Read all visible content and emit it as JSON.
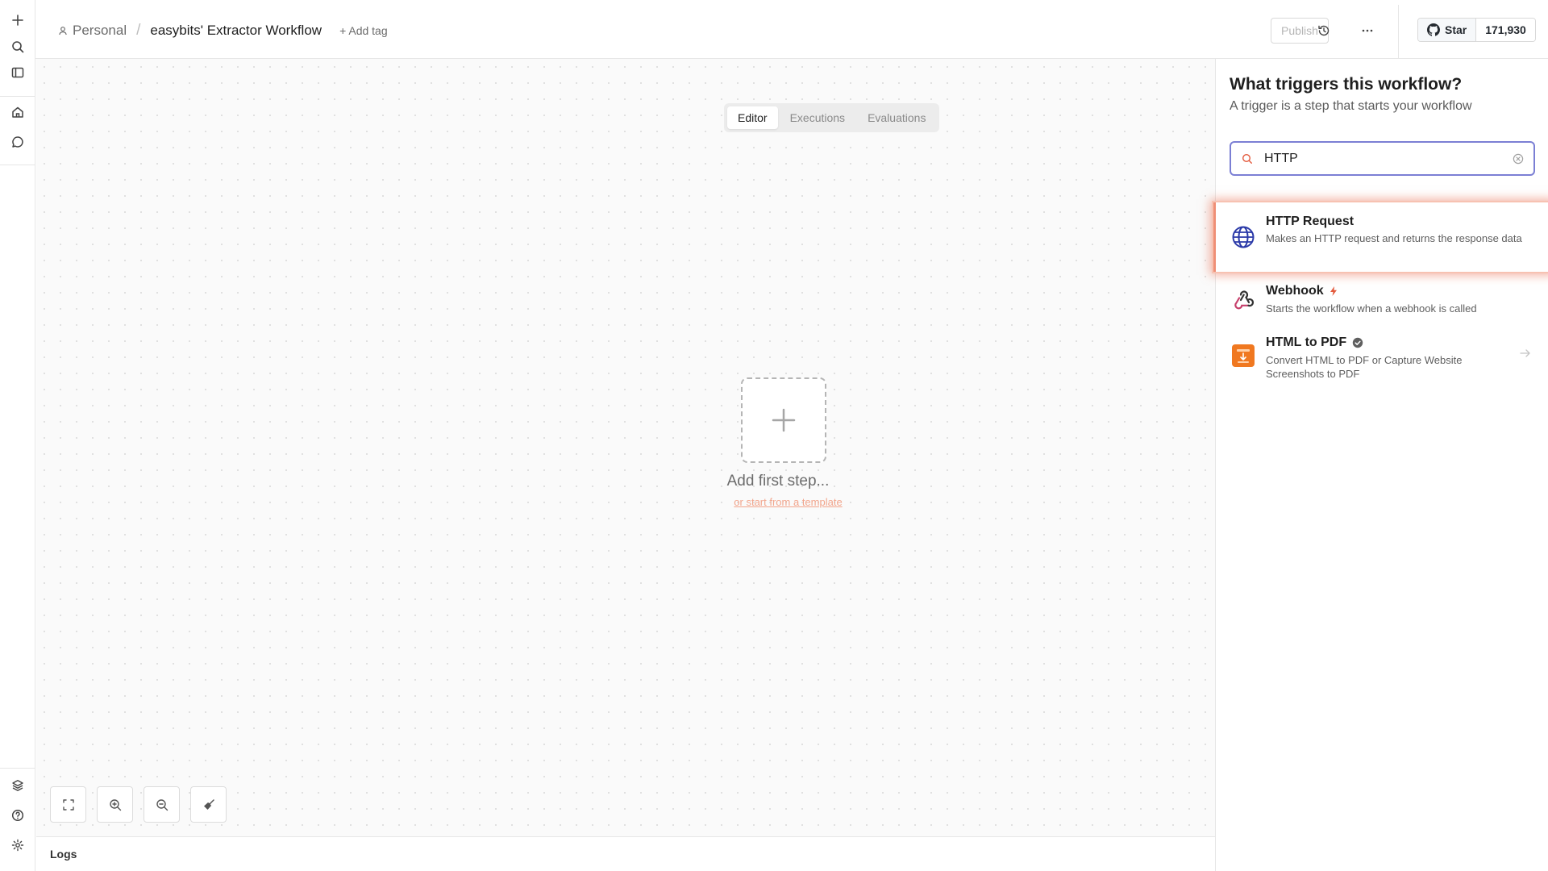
{
  "header": {
    "project": "Personal",
    "separator": "/",
    "workflow_name": "easybits' Extractor Workflow",
    "add_tag": "+ Add tag",
    "publish": "Publish",
    "github_star": "Star",
    "github_count": "171,930"
  },
  "tabs": [
    {
      "label": "Editor",
      "active": true
    },
    {
      "label": "Executions",
      "active": false
    },
    {
      "label": "Evaluations",
      "active": false
    }
  ],
  "canvas": {
    "add_first_step": "Add first step...",
    "template_link": "or start from a template"
  },
  "logs": {
    "label": "Logs"
  },
  "panel": {
    "title": "What triggers this workflow?",
    "subtitle": "A trigger is a step that starts your workflow",
    "search_value": "HTTP",
    "results": [
      {
        "title": "HTTP Request",
        "description": "Makes an HTTP request and returns the response data",
        "icon": "globe-icon",
        "selected": true
      },
      {
        "title": "Webhook",
        "description": "Starts the workflow when a webhook is called",
        "icon": "webhook-icon",
        "badge": "lightning-icon"
      },
      {
        "title": "HTML to PDF",
        "description": "Convert HTML to PDF or Capture Website Screenshots to PDF",
        "icon": "html-to-pdf-icon",
        "badge": "verified-icon"
      }
    ]
  },
  "rail_icons": [
    "plus-icon",
    "search-icon",
    "sidebar-toggle-icon",
    "home-icon",
    "chat-icon",
    "templates-icon",
    "help-icon",
    "settings-icon"
  ],
  "header_icons": [
    "history-icon",
    "more-icon",
    "github-icon"
  ],
  "colors": {
    "accent": "#e35a3d",
    "selection_glow": "#ef8f76",
    "search_border": "#7b7fd4",
    "http_icon": "#2b3aa8",
    "webhook_accent": "#c63f6b",
    "pdf_orange": "#f07820"
  }
}
